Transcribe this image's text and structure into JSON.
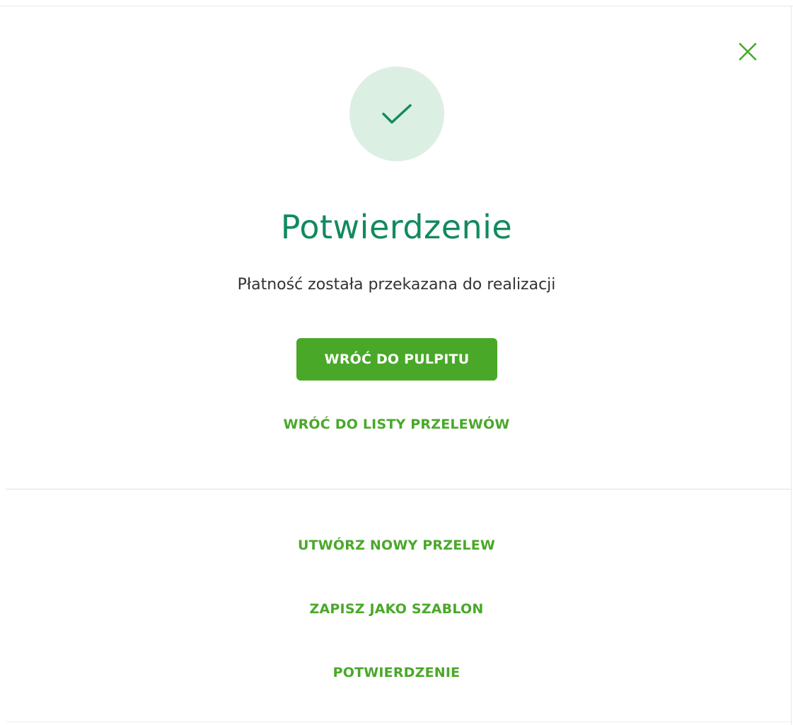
{
  "dialog": {
    "close_icon": "close-icon",
    "success_icon": "checkmark-icon",
    "title": "Potwierdzenie",
    "message": "Płatność została przekazana do realizacji",
    "primary_button_label": "WRÓĆ DO PULPITU",
    "back_to_list_label": "WRÓĆ DO LISTY PRZELEWÓW"
  },
  "actions": {
    "new_transfer_label": "UTWÓRZ NOWY PRZELEW",
    "save_template_label": "ZAPISZ JAKO SZABLON",
    "confirmation_label": "POTWIERDZENIE"
  },
  "colors": {
    "accent_green": "#4aa829",
    "title_green": "#128a5e",
    "success_circle_bg": "#dcefe3"
  }
}
